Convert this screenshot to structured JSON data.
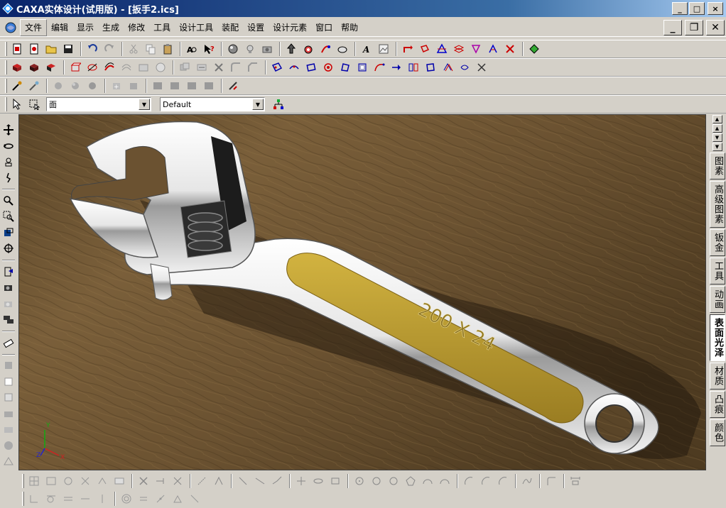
{
  "window": {
    "title": "CAXA实体设计(试用版) - [扳手2.ics]",
    "controls": {
      "minimize": "_",
      "maximize": "□",
      "close": "×"
    }
  },
  "menubar": {
    "items": [
      "文件",
      "编辑",
      "显示",
      "生成",
      "修改",
      "工具",
      "设计工具",
      "装配",
      "设置",
      "设计元素",
      "窗口",
      "帮助"
    ],
    "active_index": 0,
    "mdi": {
      "minimize": "_",
      "restore": "❐",
      "close": "✕"
    }
  },
  "selection_bar": {
    "filter_value": "面",
    "style_value": "Default"
  },
  "viewport": {
    "engraving": "200 X 24",
    "axes": {
      "x": "X",
      "y": "Y",
      "z": "Z"
    },
    "colors": {
      "wood_dark": "#4a3a22",
      "wood_light": "#8a6d44",
      "chrome": "#e8e8e8",
      "handle_inlay": "#b89a30"
    }
  },
  "right_tabs": {
    "items": [
      "图素",
      "高级图素",
      "钣金",
      "工具",
      "动画",
      "表面光泽",
      "材质",
      "凸痕",
      "颜色"
    ],
    "active_index": 5
  }
}
